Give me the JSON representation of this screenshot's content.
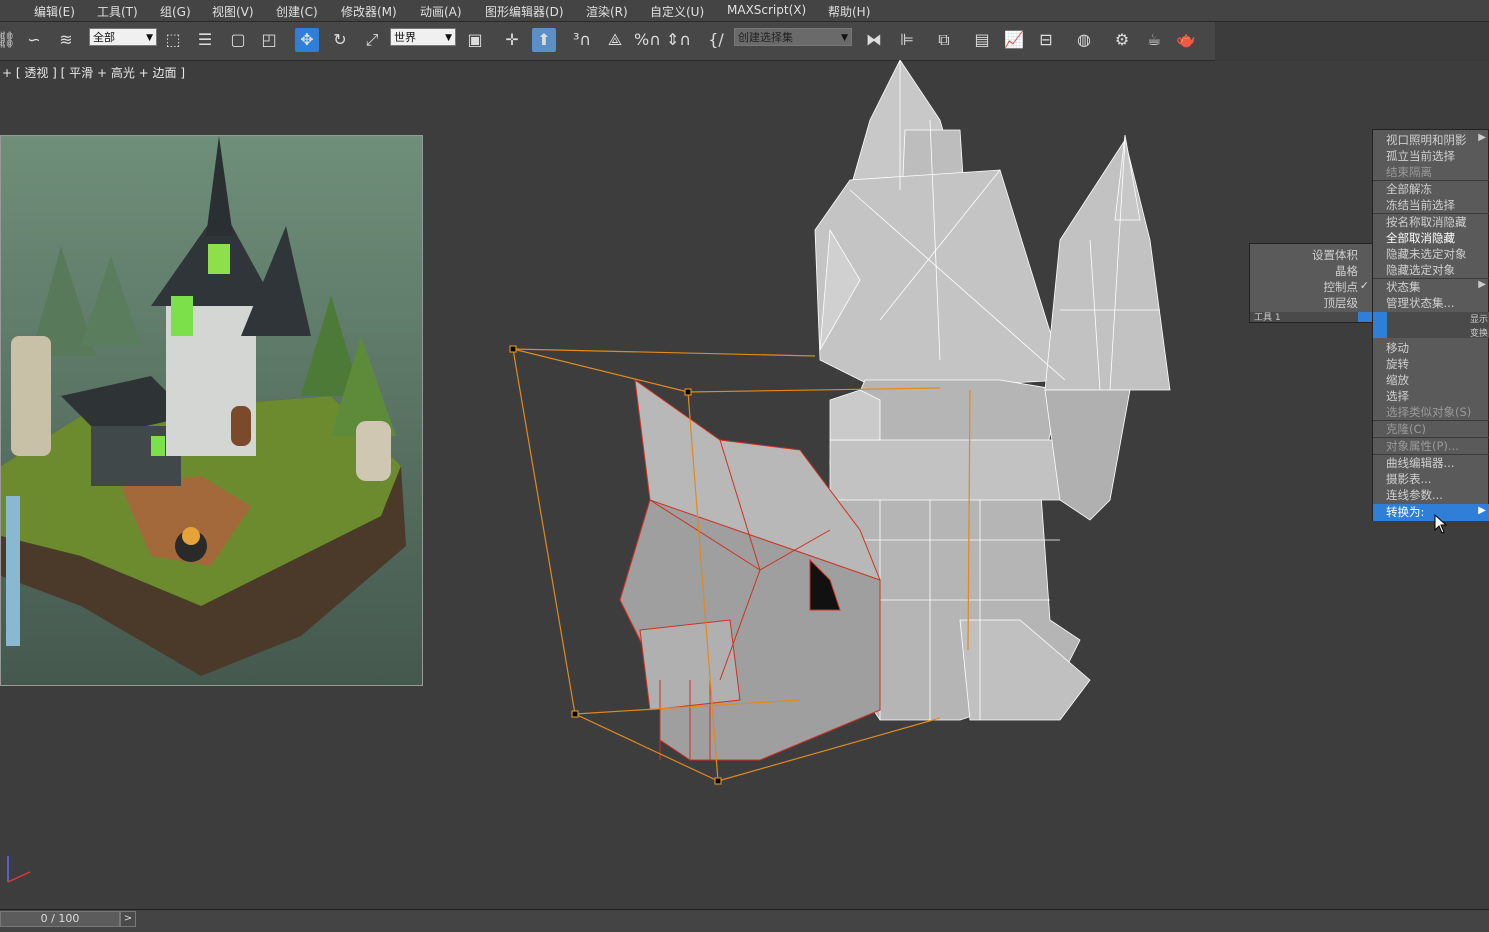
{
  "menu": [
    "编辑(E)",
    "工具(T)",
    "组(G)",
    "视图(V)",
    "创建(C)",
    "修改器(M)",
    "动画(A)",
    "图形编辑器(D)",
    "渲染(R)",
    "自定义(U)",
    "MAXScript(X)",
    "帮助(H)"
  ],
  "toolbar": {
    "selection_filter": "全部",
    "coord_system": "世界",
    "named_selection_placeholder": "创建选择集"
  },
  "viewport": {
    "label": "+ [ 透视 ] [ 平滑 + 高光 + 边面 ]"
  },
  "quad_menu": {
    "top_items": [
      "视口照明和阴影",
      "孤立当前选择",
      "结束隔离",
      "全部解冻",
      "冻结当前选择",
      "按名称取消隐藏",
      "全部取消隐藏",
      "隐藏未选定对象",
      "隐藏选定对象",
      "状态集",
      "管理状态集..."
    ],
    "tool_items": [
      "移动",
      "旋转",
      "缩放",
      "选择",
      "选择类似对象(S)",
      "克隆(C)",
      "对象属性(P)...",
      "曲线编辑器...",
      "摄影表...",
      "连线参数...",
      "转换为:"
    ],
    "highlighted": "转换为:",
    "header_left": "工具 1",
    "header_right_a": "显示",
    "header_right_b": "变换"
  },
  "sub_menu": {
    "items": [
      "设置体积",
      "晶格",
      "控制点",
      "顶层级"
    ],
    "checked": "控制点"
  },
  "timeline": {
    "frame": "0 / 100",
    "next": ">"
  },
  "colors": {
    "accent": "#2f7fd8",
    "selection_box": "#e08a1e",
    "selected_wire": "#d03020"
  }
}
